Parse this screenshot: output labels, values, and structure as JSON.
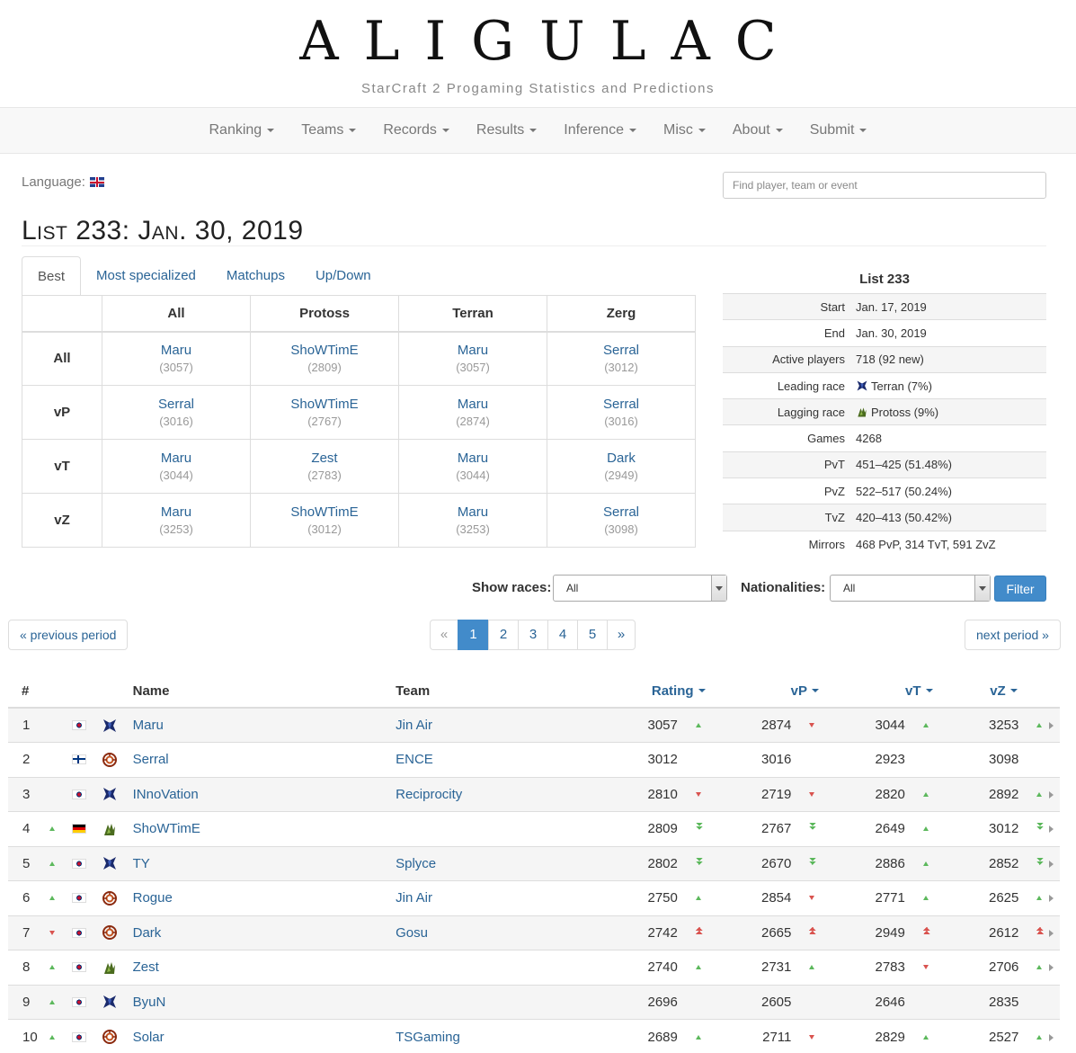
{
  "site": {
    "logo": "ALIGULAC",
    "subtitle": "StarCraft 2 Progaming Statistics and Predictions"
  },
  "nav": [
    "Ranking",
    "Teams",
    "Records",
    "Results",
    "Inference",
    "Misc",
    "About",
    "Submit"
  ],
  "language_label": "Language:",
  "search_placeholder": "Find player, team or event",
  "page_title": "List 233: Jan. 30, 2019",
  "tabs": [
    "Best",
    "Most specialized",
    "Matchups",
    "Up/Down"
  ],
  "best": {
    "columns": [
      "All",
      "Protoss",
      "Terran",
      "Zerg"
    ],
    "rows": [
      {
        "label": "All",
        "cells": [
          [
            "Maru",
            "(3057)"
          ],
          [
            "ShoWTimE",
            "(2809)"
          ],
          [
            "Maru",
            "(3057)"
          ],
          [
            "Serral",
            "(3012)"
          ]
        ]
      },
      {
        "label": "vP",
        "cells": [
          [
            "Serral",
            "(3016)"
          ],
          [
            "ShoWTimE",
            "(2767)"
          ],
          [
            "Maru",
            "(2874)"
          ],
          [
            "Serral",
            "(3016)"
          ]
        ]
      },
      {
        "label": "vT",
        "cells": [
          [
            "Maru",
            "(3044)"
          ],
          [
            "Zest",
            "(2783)"
          ],
          [
            "Maru",
            "(3044)"
          ],
          [
            "Dark",
            "(2949)"
          ]
        ]
      },
      {
        "label": "vZ",
        "cells": [
          [
            "Maru",
            "(3253)"
          ],
          [
            "ShoWTimE",
            "(3012)"
          ],
          [
            "Maru",
            "(3253)"
          ],
          [
            "Serral",
            "(3098)"
          ]
        ]
      }
    ]
  },
  "stats": {
    "title": "List 233",
    "rows": [
      {
        "k": "Start",
        "v": "Jan. 17, 2019"
      },
      {
        "k": "End",
        "v": "Jan. 30, 2019"
      },
      {
        "k": "Active players",
        "v": "718 (92 new)"
      },
      {
        "k": "Leading race",
        "v": "Terran (7%)",
        "icon": "terran-icon"
      },
      {
        "k": "Lagging race",
        "v": "Protoss (9%)",
        "icon": "protoss-icon"
      },
      {
        "k": "Games",
        "v": "4268"
      },
      {
        "k": "PvT",
        "v": "451–425 (51.48%)"
      },
      {
        "k": "PvZ",
        "v": "522–517 (50.24%)"
      },
      {
        "k": "TvZ",
        "v": "420–413 (50.42%)"
      },
      {
        "k": "Mirrors",
        "v": "468 PvP, 314 TvT, 591 ZvZ"
      }
    ]
  },
  "filters": {
    "races_label": "Show races:",
    "races_value": "All",
    "nat_label": "Nationalities:",
    "nat_value": "All",
    "button": "Filter"
  },
  "pagination": {
    "prev": "« previous period",
    "next": "next period »",
    "pages": [
      "«",
      "1",
      "2",
      "3",
      "4",
      "5",
      "»"
    ],
    "active": "1"
  },
  "ranking": {
    "headers": {
      "rank": "#",
      "name": "Name",
      "team": "Team",
      "rating": "Rating",
      "vp": "vP",
      "vt": "vT",
      "vz": "vZ"
    },
    "rows": [
      {
        "rank": "1",
        "move": "",
        "flag": "kr",
        "race": "T",
        "name": "Maru",
        "team": "Jin Air",
        "rating": "3057",
        "rt": "up",
        "vp": "2874",
        "vpt": "down",
        "vt": "3044",
        "vtt": "up",
        "vz": "3253",
        "vzt": "up",
        "exp": true
      },
      {
        "rank": "2",
        "move": "",
        "flag": "fi",
        "race": "Z",
        "name": "Serral",
        "team": "ENCE",
        "rating": "3012",
        "rt": "",
        "vp": "3016",
        "vpt": "",
        "vt": "2923",
        "vtt": "",
        "vz": "3098",
        "vzt": "",
        "exp": false
      },
      {
        "rank": "3",
        "move": "",
        "flag": "kr",
        "race": "T",
        "name": "INnoVation",
        "team": "Reciprocity",
        "rating": "2810",
        "rt": "down",
        "vp": "2719",
        "vpt": "down",
        "vt": "2820",
        "vtt": "up",
        "vz": "2892",
        "vzt": "up",
        "exp": true
      },
      {
        "rank": "4",
        "move": "up",
        "flag": "de",
        "race": "P",
        "name": "ShoWTimE",
        "team": "",
        "rating": "2809",
        "rt": "up2",
        "vp": "2767",
        "vpt": "up2",
        "vt": "2649",
        "vtt": "up",
        "vz": "3012",
        "vzt": "up2",
        "exp": true
      },
      {
        "rank": "5",
        "move": "up",
        "flag": "kr",
        "race": "T",
        "name": "TY",
        "team": "Splyce",
        "rating": "2802",
        "rt": "up2",
        "vp": "2670",
        "vpt": "up2",
        "vt": "2886",
        "vtt": "up",
        "vz": "2852",
        "vzt": "up2",
        "exp": true
      },
      {
        "rank": "6",
        "move": "up",
        "flag": "kr",
        "race": "Z",
        "name": "Rogue",
        "team": "Jin Air",
        "rating": "2750",
        "rt": "up",
        "vp": "2854",
        "vpt": "down",
        "vt": "2771",
        "vtt": "up",
        "vz": "2625",
        "vzt": "up",
        "exp": true
      },
      {
        "rank": "7",
        "move": "down",
        "flag": "kr",
        "race": "Z",
        "name": "Dark",
        "team": "Gosu",
        "rating": "2742",
        "rt": "down2",
        "vp": "2665",
        "vpt": "down2",
        "vt": "2949",
        "vtt": "down2",
        "vz": "2612",
        "vzt": "down2",
        "exp": true
      },
      {
        "rank": "8",
        "move": "up",
        "flag": "kr",
        "race": "P",
        "name": "Zest",
        "team": "",
        "rating": "2740",
        "rt": "up",
        "vp": "2731",
        "vpt": "up",
        "vt": "2783",
        "vtt": "down",
        "vz": "2706",
        "vzt": "up",
        "exp": true
      },
      {
        "rank": "9",
        "move": "up",
        "flag": "kr",
        "race": "T",
        "name": "ByuN",
        "team": "",
        "rating": "2696",
        "rt": "",
        "vp": "2605",
        "vpt": "",
        "vt": "2646",
        "vtt": "",
        "vz": "2835",
        "vzt": "",
        "exp": false
      },
      {
        "rank": "10",
        "move": "up",
        "flag": "kr",
        "race": "Z",
        "name": "Solar",
        "team": "TSGaming",
        "rating": "2689",
        "rt": "up",
        "vp": "2711",
        "vpt": "down",
        "vt": "2829",
        "vtt": "up",
        "vz": "2527",
        "vzt": "up",
        "exp": true
      }
    ]
  }
}
